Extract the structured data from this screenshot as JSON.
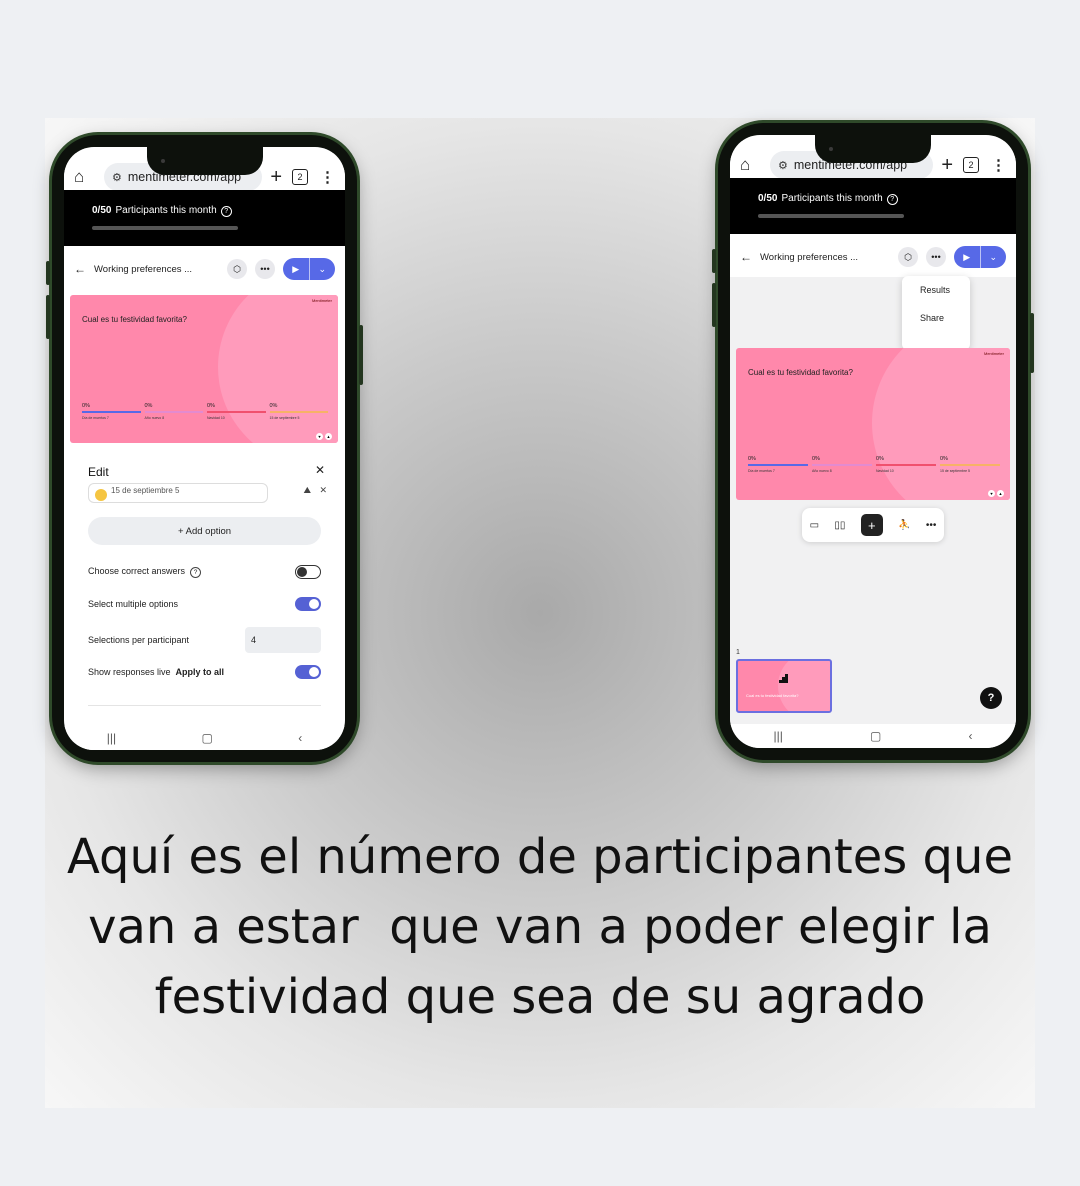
{
  "caption": {
    "lines": [
      "Aquí es el número de participantes que",
      "van a estar  que van a poder elegir la",
      "festividad que sea de su agrado"
    ]
  },
  "browser": {
    "url": "mentimeter.com/app",
    "tab_count": "2"
  },
  "participants": {
    "count": "0/50",
    "label": "Participants this month"
  },
  "presentation": {
    "title": "Working preferences ...",
    "slide_question": "Cual es  tu festividad favorita?",
    "brand": "Mentimeter",
    "options": [
      {
        "pct": "0%",
        "label": "Día de muertos 7",
        "color": "#5769e7"
      },
      {
        "pct": "0%",
        "label": "Año nuevo 8",
        "color": "#e38bd0"
      },
      {
        "pct": "0%",
        "label": "Navidad 10",
        "color": "#f0506e"
      },
      {
        "pct": "0%",
        "label": "15 de septiembre 5",
        "color": "#f7b267"
      }
    ]
  },
  "edit_panel": {
    "heading": "Edit",
    "partial_option": "15 de septiembre 5",
    "add_option": "+ Add option",
    "settings": {
      "correct_answers": "Choose correct answers",
      "multiple": "Select multiple options",
      "selections_label": "Selections per participant",
      "selections_value": "4",
      "responses_live": "Show responses live",
      "apply_all": "Apply to all"
    }
  },
  "menu": {
    "results": "Results",
    "share": "Share"
  },
  "thumbnail": {
    "number": "1",
    "text": "Cual es tu festividad favorita?"
  },
  "help": "?",
  "colors": {
    "accent": "#5769e7",
    "slide_pink": "#ff88ab",
    "toggle_on": "#5561d4"
  }
}
